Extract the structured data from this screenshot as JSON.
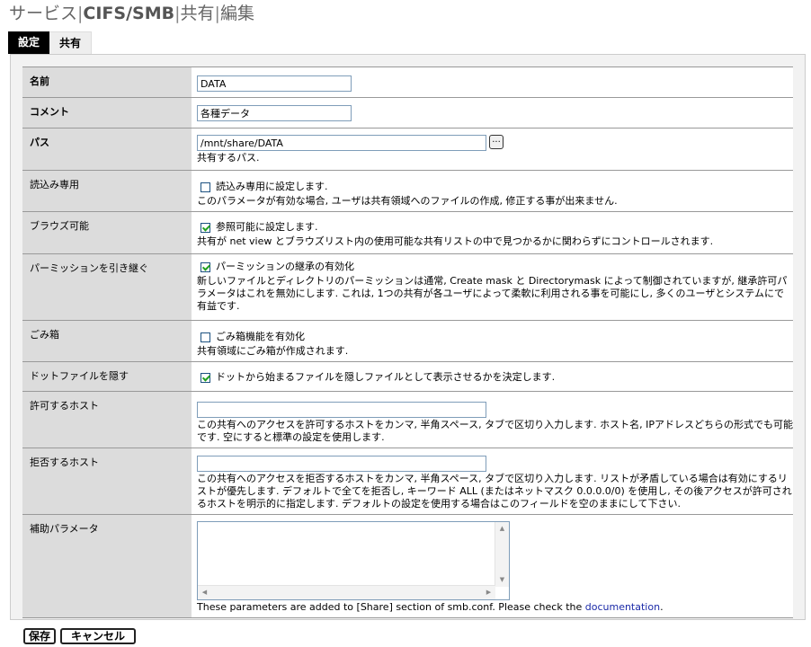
{
  "title": {
    "part1": "サービス",
    "sep": "|",
    "part2": "CIFS/SMB",
    "part3": "共有",
    "part4": "編集"
  },
  "tabs": [
    {
      "label": "設定",
      "active": true
    },
    {
      "label": "共有",
      "active": false
    }
  ],
  "fields": {
    "name": {
      "label": "名前",
      "value": "DATA"
    },
    "comment": {
      "label": "コメント",
      "value": "各種データ"
    },
    "path": {
      "label": "パス",
      "value": "/mnt/share/DATA",
      "browse_label": "...",
      "desc": "共有するパス."
    },
    "readonly": {
      "label": "読込み専用",
      "checked": false,
      "check_label": "読込み専用に設定します.",
      "desc": "このパラメータが有効な場合, ユーザは共有領域へのファイルの作成, 修正する事が出来ません."
    },
    "browseable": {
      "label": "ブラウズ可能",
      "checked": true,
      "check_label": "参照可能に設定します.",
      "desc": "共有が net view とブラウズリスト内の使用可能な共有リストの中で見つかるかに関わらずにコントロールされます."
    },
    "inherit": {
      "label": "パーミッションを引き継ぐ",
      "checked": true,
      "check_label": "パーミッションの継承の有効化",
      "desc": "新しいファイルとディレクトリのパーミッションは通常, Create mask と Directorymask によって制御されていますが, 継承許可パラメータはこれを無効にします. これは, 1つの共有が各ユーザによって柔軟に利用される事を可能にし, 多くのユーザとシステムにで有益です."
    },
    "recycle": {
      "label": "ごみ箱",
      "checked": false,
      "check_label": "ごみ箱機能を有効化",
      "desc": "共有領域にごみ箱が作成されます."
    },
    "hidedot": {
      "label": "ドットファイルを隠す",
      "checked": true,
      "check_label": "ドットから始まるファイルを隠しファイルとして表示させるかを決定します."
    },
    "hostsallow": {
      "label": "許可するホスト",
      "value": "",
      "desc": "この共有へのアクセスを許可するホストをカンマ, 半角スペース, タブで区切り入力します. ホスト名, IPアドレスどちらの形式でも可能です. 空にすると標準の設定を使用します."
    },
    "hostsdeny": {
      "label": "拒否するホスト",
      "value": "",
      "desc": "この共有へのアクセスを拒否するホストをカンマ, 半角スペース, タブで区切り入力します. リストが矛盾している場合は有効にするリストが優先します. デフォルトで全てを拒否し, キーワード ALL (またはネットマスク 0.0.0.0/0) を使用し, その後アクセスが許可されるホストを明示的に指定します. デフォルトの設定を使用する場合はこのフィールドを空のままにして下さい."
    },
    "auxparam": {
      "label": "補助パラメータ",
      "value": "",
      "desc_before": "These parameters are added to [Share] section of smb.conf. Please check the ",
      "link": "documentation",
      "desc_after": "."
    }
  },
  "buttons": {
    "save": "保存",
    "cancel": "キャンセル"
  },
  "colors": {
    "label_bg": "#dcdcdc",
    "panel_bg": "#f2f2f2",
    "link": "#1b2aa8",
    "check": "#21a121"
  }
}
